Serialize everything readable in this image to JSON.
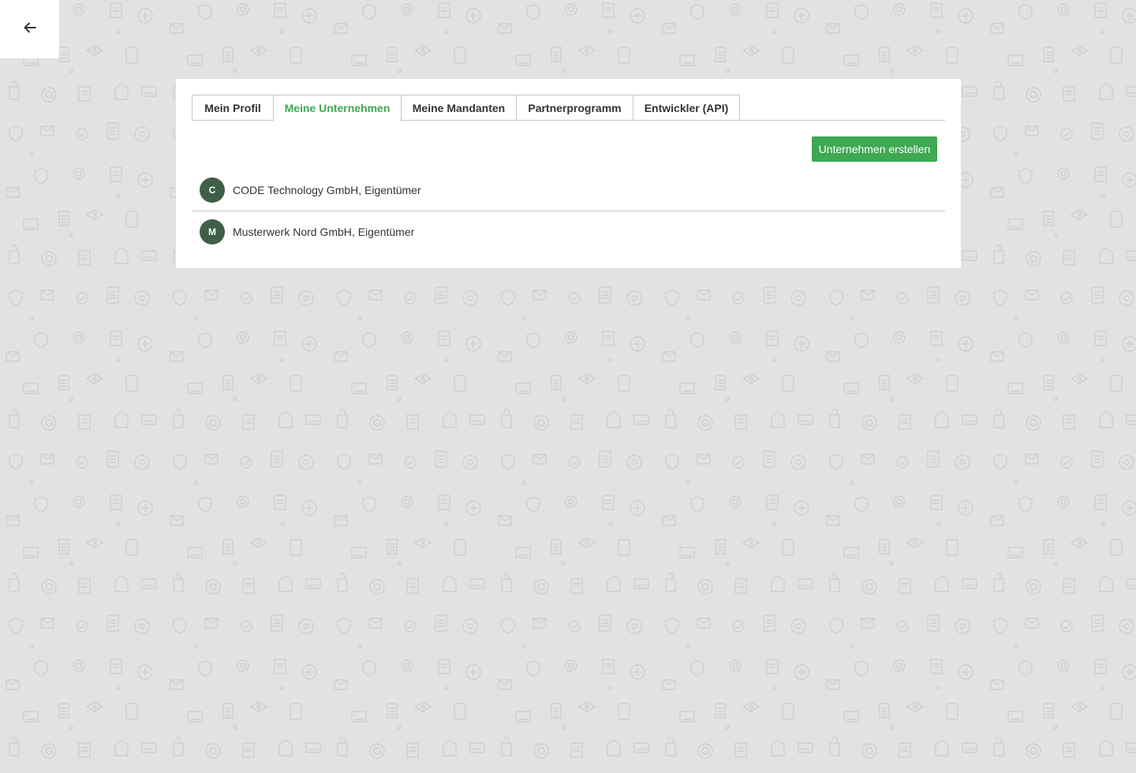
{
  "colors": {
    "accent": "#3ea853",
    "active_tab": "#3daa52",
    "avatar_bg": "#3f5f46",
    "background": "#e2e2e2"
  },
  "back_button": {
    "icon": "arrow-left-icon"
  },
  "tabs": [
    {
      "label": "Mein Profil",
      "active": false
    },
    {
      "label": "Meine Unternehmen",
      "active": true
    },
    {
      "label": "Meine Mandanten",
      "active": false
    },
    {
      "label": "Partnerprogramm",
      "active": false
    },
    {
      "label": "Entwickler (API)",
      "active": false
    }
  ],
  "actions": {
    "create_company_label": "Unternehmen erstellen"
  },
  "companies": [
    {
      "initial": "C",
      "label": "CODE Technology GmbH, Eigentümer"
    },
    {
      "initial": "M",
      "label": "Musterwerk Nord GmbH, Eigentümer"
    }
  ]
}
